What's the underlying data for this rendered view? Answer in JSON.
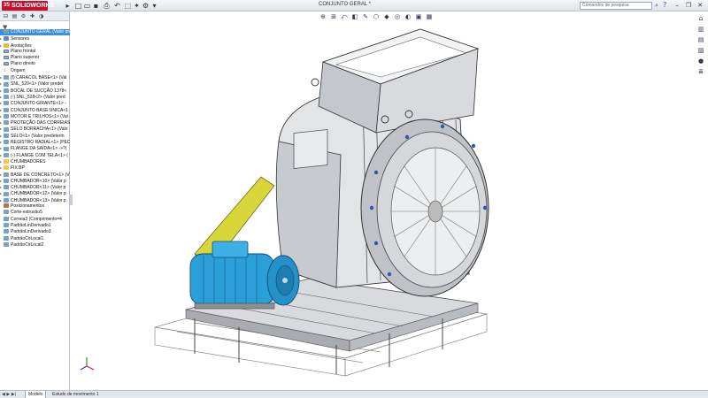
{
  "app": {
    "brand": "SOLIDWORKS",
    "brand_prefix": "3S",
    "document_title": "CONJUNTO GERAL *"
  },
  "search": {
    "placeholder": "Comandos de pesquisa"
  },
  "window_controls": {
    "minimize": "–",
    "restore": "❐",
    "close": "✕"
  },
  "tree": {
    "items": [
      {
        "label": "CONJUNTO GERAL  (Valor pred",
        "icon": "assembly-icon",
        "root": true
      },
      {
        "label": "Sensores",
        "icon": "sensor-icon"
      },
      {
        "label": "Anotações",
        "icon": "annotation-icon"
      },
      {
        "label": "Plano frontal",
        "icon": "plane-icon"
      },
      {
        "label": "Plano superior",
        "icon": "plane-icon"
      },
      {
        "label": "Plano direito",
        "icon": "plane-icon"
      },
      {
        "label": "Origem",
        "icon": "origin-icon"
      },
      {
        "label": "(f) CARACOL BASE<1> (Val",
        "icon": "part-icon"
      },
      {
        "label": "SNL_520<1> (Valor predet",
        "icon": "part-icon"
      },
      {
        "label": "BOCAL DE SUCÇÃO 1378<",
        "icon": "part-icon"
      },
      {
        "label": "(-) SNL_528<2> (Valor pred",
        "icon": "part-icon"
      },
      {
        "label": "CONJUNTO GIRANTE<1> -",
        "icon": "part-icon"
      },
      {
        "label": "CONJUNTO BASE UNICA<1",
        "icon": "part-icon"
      },
      {
        "label": "MOTOR E TRILHOS<1> (Val",
        "icon": "part-icon"
      },
      {
        "label": "PROTEÇÃO DAS CORREIAS",
        "icon": "part-icon"
      },
      {
        "label": "SELO BORRACHA<1> (Valo",
        "icon": "part-icon"
      },
      {
        "label": "SELO<1> (Valor predeterm",
        "icon": "part-icon"
      },
      {
        "label": "REGISTRO RADIAL<1> (PEC",
        "icon": "part-icon"
      },
      {
        "label": "FLANGE DA SAÍDA<1> ->?(",
        "icon": "part-icon"
      },
      {
        "label": "(-) FLANGE COM TELA<1> (",
        "icon": "part-icon"
      },
      {
        "label": "CHUMBADORES",
        "icon": "folder-icon"
      },
      {
        "label": "FIX BP",
        "icon": "folder-icon"
      },
      {
        "label": "BASE DE CONCRETO<1> (V",
        "icon": "part-icon"
      },
      {
        "label": "CHUMBADOR<10> (Valor p",
        "icon": "part-icon"
      },
      {
        "label": "CHUMBADOR<11> (Valor p",
        "icon": "part-icon"
      },
      {
        "label": "CHUMBADOR<12> (Valor p",
        "icon": "part-icon"
      },
      {
        "label": "CHUMBADOR<13> (Valor p",
        "icon": "part-icon"
      },
      {
        "label": "Posicionamentos",
        "icon": "mate-icon"
      },
      {
        "label": "Corte-extrusão5",
        "icon": "part-icon"
      },
      {
        "label": "Correia3 (Comprimento=4",
        "icon": "part-icon"
      },
      {
        "label": "PadrãoLinDerivado1",
        "icon": "part-icon"
      },
      {
        "label": "PadrãoLinDerivado3",
        "icon": "part-icon"
      },
      {
        "label": "PadrãoCirLocal1",
        "icon": "part-icon"
      },
      {
        "label": "PadrãoCirLocal2",
        "icon": "part-icon"
      }
    ]
  },
  "status_tabs": {
    "model": "Modelo",
    "motion": "Estudo de movimento 1",
    "nav": "◀ ▶ ▶|"
  },
  "colors": {
    "motor_blue": "#2a9fd8",
    "guard_yellow": "#d8d63a",
    "steel": "#c9ccd0",
    "brand_red": "#c8102e",
    "selection_blue": "#3a8fd9"
  }
}
